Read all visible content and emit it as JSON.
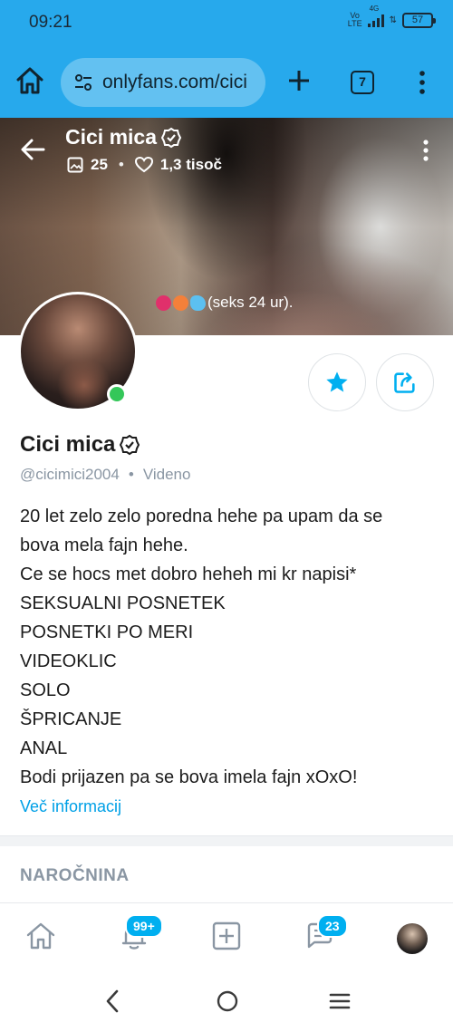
{
  "status_bar": {
    "time": "09:21",
    "network_top": "Vo",
    "network_bottom": "LTE",
    "network_gen": "4G",
    "battery": "57"
  },
  "browser": {
    "url": "onlyfans.com/cici",
    "tab_count": "7",
    "icons": [
      "home-icon",
      "site-settings-icon",
      "new-tab-icon",
      "tab-switcher",
      "menu-icon"
    ]
  },
  "banner": {
    "name": "Cici mica",
    "posts_count": "25",
    "likes_count": "1,3 tisoč",
    "caption": "(seks 24 ur)."
  },
  "profile": {
    "name": "Cici mica",
    "handle": "@cicimici2004",
    "last_seen": "Videno",
    "bio_lines": [
      "20 let zelo zelo poredna hehe pa upam da se",
      "bova mela fajn hehe.",
      "Ce se hocs met dobro heheh mi kr napisi*",
      "SEKSUALNI POSNETEK",
      "POSNETKI PO MERI",
      "VIDEOKLIC",
      "SOLO",
      "ŠPRICANJE",
      "ANAL",
      "Bodi prijazen pa se bova imela fajn xOxO!"
    ],
    "more_info": "Več informacij"
  },
  "subscription": {
    "heading": "NAROČNINA"
  },
  "bottom_nav": {
    "notifications_badge": "99+",
    "messages_badge": "23"
  },
  "colors": {
    "accent": "#00aff0",
    "browser_bar": "#27a9ec",
    "online": "#34c759"
  }
}
